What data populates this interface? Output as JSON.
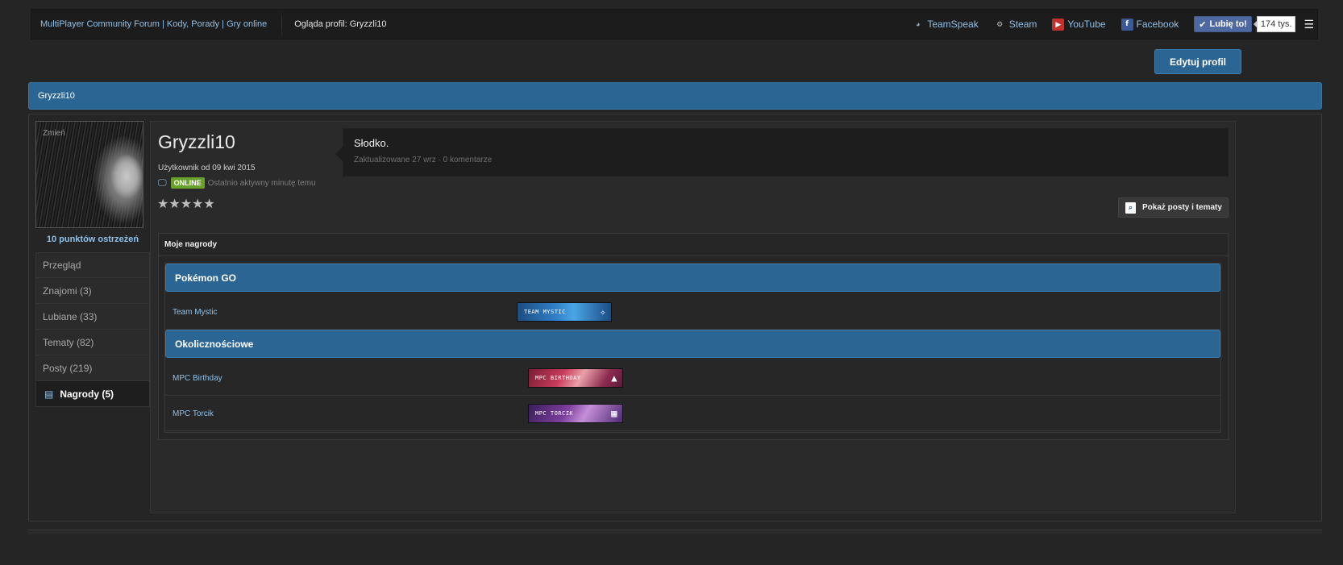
{
  "breadcrumb": {
    "home": "MultiPlayer Community Forum | Kody, Porady | Gry online",
    "current": "Ogląda profil: Gryzzli10"
  },
  "social": {
    "items": [
      {
        "label": "TeamSpeak",
        "icon": "teamspeak-icon"
      },
      {
        "label": "Steam",
        "icon": "steam-icon"
      },
      {
        "label": "YouTube",
        "icon": "youtube-icon"
      },
      {
        "label": "Facebook",
        "icon": "facebook-icon"
      }
    ],
    "like_label": "Lubię to!",
    "like_count": "174 tys."
  },
  "actions": {
    "edit_profile": "Edytuj profil"
  },
  "title_bar": "Gryzzli10",
  "profile": {
    "avatar_overlay": "Zmień",
    "warning_points": "10 punktów ostrzeżeń",
    "username": "Gryzzli10",
    "member_since": "Użytkownik od 09 kwi 2015",
    "online_badge": "ONLINE",
    "last_active": "Ostatnio aktywny minutę temu",
    "rating": "★★★★★"
  },
  "nav": {
    "items": [
      {
        "label": "Przegląd"
      },
      {
        "label": "Znajomi (3)"
      },
      {
        "label": "Lubiane (33)"
      },
      {
        "label": "Tematy (82)"
      },
      {
        "label": "Posty (219)"
      }
    ],
    "active_label": "Nagrody (5)"
  },
  "status": {
    "text": "Słodko.",
    "meta": "Zaktualizowane 27 wrz · 0 komentarze"
  },
  "posts_button": "Pokaż posty i tematy",
  "awards": {
    "title": "Moje nagrody",
    "categories": [
      {
        "name": "Pokémon GO",
        "items": [
          {
            "name": "Team Mystic",
            "banner": "TEAM MYSTIC"
          }
        ]
      },
      {
        "name": "Okolicznościowe",
        "items": [
          {
            "name": "MPC Birthday",
            "banner": "MPC BIRTHDAY"
          },
          {
            "name": "MPC Torcik",
            "banner": "MPC TORCIK"
          }
        ]
      }
    ]
  },
  "colors": {
    "accent": "#2b6593",
    "link": "#8fc0e8",
    "online": "#6aa12a",
    "background": "#252525"
  }
}
